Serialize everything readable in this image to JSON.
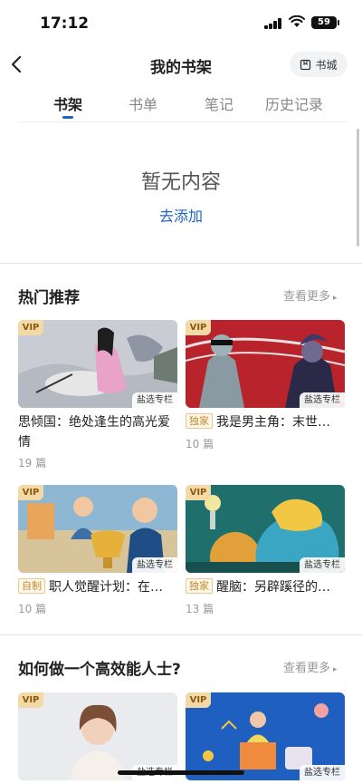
{
  "status": {
    "time": "17:12",
    "battery": "59"
  },
  "header": {
    "title": "我的书架",
    "bookstore_label": "书城"
  },
  "tabs": [
    {
      "label": "书架",
      "active": true
    },
    {
      "label": "书单",
      "active": false
    },
    {
      "label": "笔记",
      "active": false
    },
    {
      "label": "历史记录",
      "active": false
    }
  ],
  "empty_state": {
    "title": "暂无内容",
    "action": "去添加"
  },
  "hot": {
    "title": "热门推荐",
    "more": "查看更多",
    "cards": [
      {
        "vip": "VIP",
        "column": "盐选专栏",
        "tag": "",
        "title": "思倾国：绝处逢生的高光爱情",
        "count": "19 篇"
      },
      {
        "vip": "VIP",
        "column": "盐选专栏",
        "tag": "独家",
        "title": "我是男主角：末世…",
        "count": "10 篇"
      },
      {
        "vip": "VIP",
        "column": "盐选专栏",
        "tag": "自制",
        "title": "职人觉醒计划：在…",
        "count": "10 篇"
      },
      {
        "vip": "VIP",
        "column": "盐选专栏",
        "tag": "独家",
        "title": "醒脑：另辟蹊径的…",
        "count": "13 篇"
      }
    ]
  },
  "efficient": {
    "title": "如何做一个高效能人士?",
    "more": "查看更多",
    "cards": [
      {
        "vip": "VIP",
        "column": "盐选专栏"
      },
      {
        "vip": "VIP",
        "column": "盐选专栏"
      }
    ]
  },
  "colors": {
    "accent": "#1f63c6",
    "vip_bg": "#f2d9a6",
    "tag_text": "#c48a2c"
  }
}
